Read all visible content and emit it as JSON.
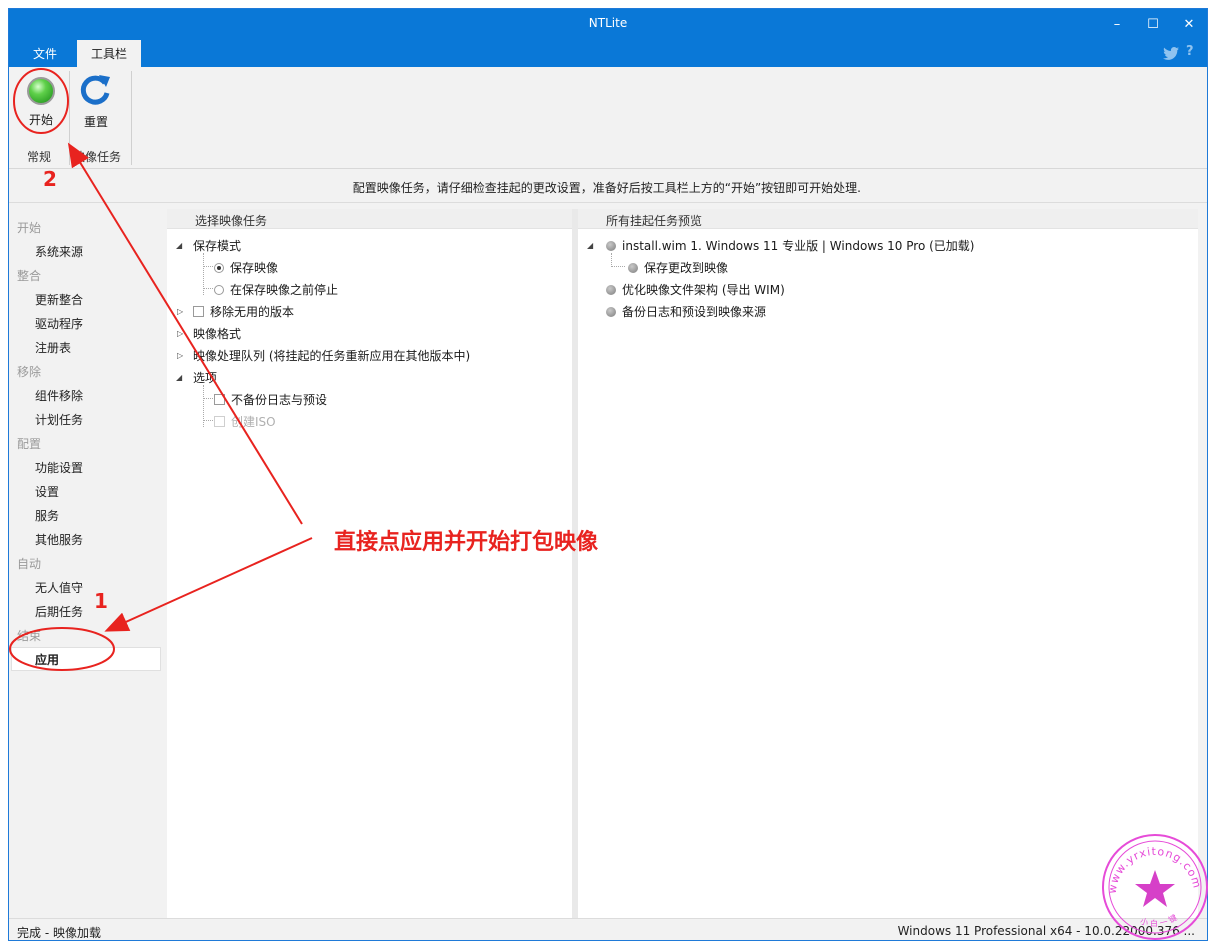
{
  "window": {
    "title": "NTLite"
  },
  "window_controls": {
    "minimize": "–",
    "maximize": "☐",
    "close": "✕"
  },
  "tabs": [
    {
      "label": "文件",
      "active": false
    },
    {
      "label": "工具栏",
      "active": true
    }
  ],
  "social": {
    "twitter": "twitter-icon",
    "help": "?"
  },
  "ribbon": {
    "start_label": "开始",
    "reset_label": "重置",
    "groups": [
      {
        "label": "常规"
      },
      {
        "label": "映像任务"
      }
    ]
  },
  "info_message": "配置映像任务，请仔细检查挂起的更改设置，准备好后按工具栏上方的“开始”按钮即可开始处理.",
  "sidebar": {
    "sections": [
      {
        "category": "开始",
        "items": [
          "系统来源"
        ]
      },
      {
        "category": "整合",
        "items": [
          "更新整合",
          "驱动程序",
          "注册表"
        ]
      },
      {
        "category": "移除",
        "items": [
          "组件移除",
          "计划任务"
        ]
      },
      {
        "category": "配置",
        "items": [
          "功能设置",
          "设置",
          "服务",
          "其他服务"
        ]
      },
      {
        "category": "自动",
        "items": [
          "无人值守",
          "后期任务"
        ]
      },
      {
        "category": "结束",
        "items": [
          "应用"
        ]
      }
    ],
    "active_item": "应用"
  },
  "left_panel": {
    "header": "选择映像任务",
    "save_mode": "保存模式",
    "save_image": "保存映像",
    "stop_before_save": "在保存映像之前停止",
    "remove_unused": "移除无用的版本",
    "image_format": "映像格式",
    "queue": "映像处理队列 (将挂起的任务重新应用在其他版本中)",
    "options": "选项",
    "no_backup": "不备份日志与预设",
    "create_iso": "创建ISO"
  },
  "right_panel": {
    "header": "所有挂起任务预览",
    "image_entry": "install.wim 1. Windows 11 专业版  |  Windows 10 Pro  (已加载)",
    "save_changes": "保存更改到映像",
    "optimize": "优化映像文件架构 (导出 WIM)",
    "backup": "备份日志和预设到映像来源"
  },
  "status": {
    "left": "完成 - 映像加载",
    "right": "Windows 11 Professional x64 - 10.0.22000.376 ..."
  },
  "annotation": {
    "text": "直接点应用并开始打包映像",
    "num1": "1",
    "num2": "2",
    "color": "#e8231f"
  },
  "watermark": {
    "url": "www.yrxitong.com",
    "bottom": "小 白 一 键"
  },
  "colors": {
    "accent": "#0a78d7",
    "annotation": "#e8231f",
    "watermark": "#e64bd8"
  }
}
